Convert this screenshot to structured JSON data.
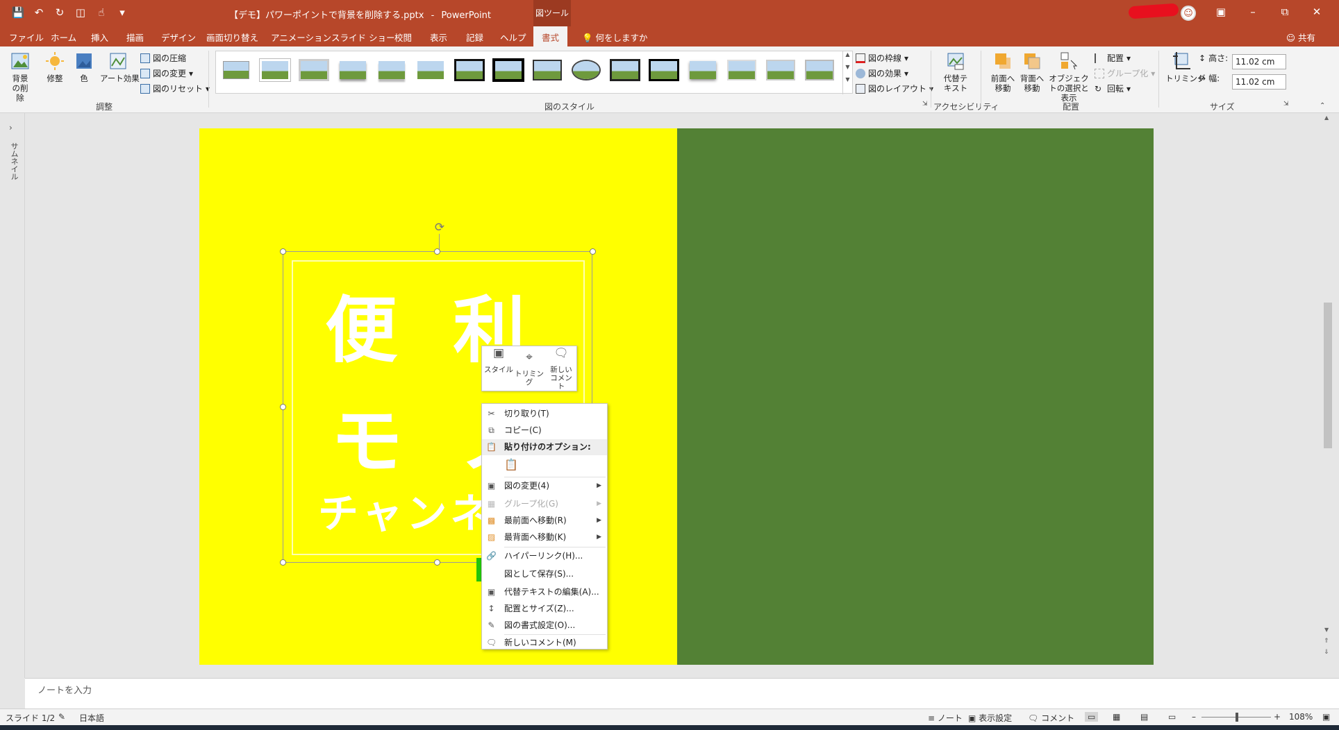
{
  "app": {
    "file_title": "【デモ】パワーポイントで背景を削除する.pptx",
    "separator": "-",
    "app_name": "PowerPoint",
    "context_tab_group": "図ツール",
    "accent_color": "#b7472a"
  },
  "tabs": [
    "ファイル",
    "ホーム",
    "挿入",
    "描画",
    "デザイン",
    "画面切り替え",
    "アニメーション",
    "スライド ショー",
    "校閲",
    "表示",
    "記録",
    "ヘルプ",
    "書式"
  ],
  "active_tab": "書式",
  "tell_me": "何をしますか",
  "share": "共有",
  "ribbon": {
    "adjust": {
      "remove_bg": "背景の削除",
      "corrections": "修整",
      "color": "色",
      "artistic": "アート効果",
      "compress": "図の圧縮",
      "change": "図の変更",
      "reset": "図のリセット",
      "label": "調整"
    },
    "styles": {
      "border": "図の枠線",
      "effects": "図の効果",
      "layout": "図のレイアウト",
      "label": "図のスタイル"
    },
    "accessibility": {
      "alt_text": "代替テキスト",
      "label": "アクセシビリティ"
    },
    "arrange": {
      "bring_forward": "前面へ移動",
      "send_backward": "背面へ移動",
      "selection_pane": "オブジェクトの選択と表示",
      "align": "配置",
      "group": "グループ化",
      "rotate": "回転",
      "label": "配置"
    },
    "size": {
      "crop": "トリミング",
      "height_label": "高さ:",
      "height_value": "11.02 cm",
      "width_label": "幅:",
      "width_value": "11.02 cm",
      "label": "サイズ"
    }
  },
  "left_panel": {
    "label": "サムネイル"
  },
  "slide": {
    "left_color": "#ffff00",
    "right_color": "#538135",
    "picture_text": {
      "line1": "便 利",
      "line2": "モ ノ",
      "line3": "チャンネ"
    }
  },
  "mini_toolbar": {
    "style": "スタイル",
    "crop": "トリミング",
    "new_comment": "新しいコメント"
  },
  "context_menu": {
    "cut": "切り取り(T)",
    "copy": "コピー(C)",
    "paste_options": "貼り付けのオプション:",
    "change_picture": "図の変更(4)",
    "group": "グループ化(G)",
    "bring_to_front": "最前面へ移動(R)",
    "send_to_back": "最背面へ移動(K)",
    "hyperlink": "ハイパーリンク(H)...",
    "save_as_picture": "図として保存(S)...",
    "edit_alt_text": "代替テキストの編集(A)...",
    "size_position": "配置とサイズ(Z)...",
    "format_picture": "図の書式設定(O)...",
    "new_comment": "新しいコメント(M)",
    "highlight_color": "#22c40a"
  },
  "notes": {
    "placeholder": "ノートを入力"
  },
  "status": {
    "slide": "スライド 1/2",
    "language": "日本語",
    "notes": "ノート",
    "display_settings": "表示設定",
    "comments": "コメント",
    "zoom": "108%"
  }
}
